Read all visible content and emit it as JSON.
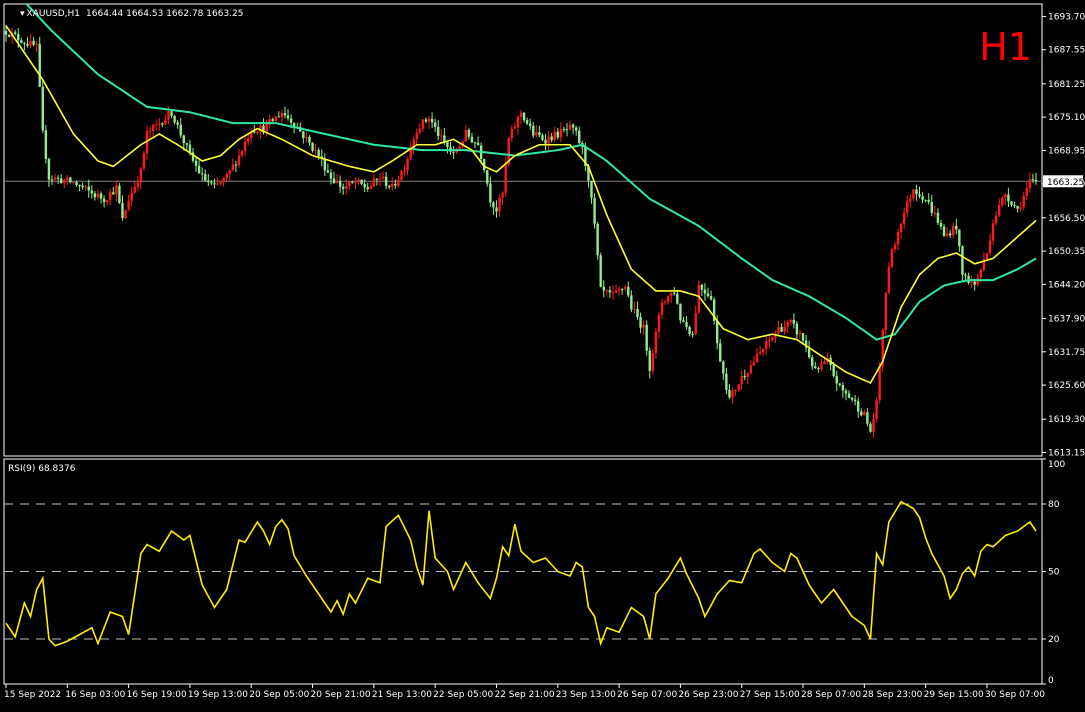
{
  "header": {
    "symbol": "XAUUSD,H1",
    "ohlc": "1664.44 1664.53 1662.78 1663.25",
    "timeframe_label": "H1"
  },
  "colors": {
    "background": "#000000",
    "axis": "#ffffff",
    "bull": "#ff1a1a",
    "bear": "#90ee90",
    "ma_fast": "#ffff33",
    "ma_slow": "#2ee8a4",
    "rsi": "#ffee00",
    "timeframe": "#ff0000",
    "price_line": "#808080"
  },
  "chart_data": [
    {
      "type": "candlestick",
      "title": "XAUUSD,H1",
      "yticks": [
        "1693.70",
        "1687.55",
        "1681.25",
        "1675.10",
        "1668.95",
        "1662.80",
        "1656.50",
        "1650.35",
        "1644.20",
        "1637.90",
        "1631.75",
        "1625.60",
        "1619.30",
        "1613.15"
      ],
      "ylim": [
        1612.5,
        1696.0
      ],
      "current_price": "1663.25",
      "anchors": [
        [
          0,
          1691
        ],
        [
          6,
          1689
        ],
        [
          10,
          1688
        ],
        [
          12,
          1672
        ],
        [
          14,
          1664
        ],
        [
          22,
          1663
        ],
        [
          28,
          1661
        ],
        [
          32,
          1660
        ],
        [
          36,
          1662
        ],
        [
          38,
          1656
        ],
        [
          40,
          1660
        ],
        [
          44,
          1665
        ],
        [
          46,
          1672
        ],
        [
          50,
          1674
        ],
        [
          54,
          1676
        ],
        [
          57,
          1672
        ],
        [
          60,
          1668
        ],
        [
          64,
          1664
        ],
        [
          68,
          1662
        ],
        [
          72,
          1664
        ],
        [
          76,
          1668
        ],
        [
          80,
          1673
        ],
        [
          84,
          1673
        ],
        [
          90,
          1676
        ],
        [
          94,
          1674
        ],
        [
          98,
          1671
        ],
        [
          102,
          1668
        ],
        [
          106,
          1664
        ],
        [
          110,
          1662
        ],
        [
          114,
          1663
        ],
        [
          118,
          1662
        ],
        [
          122,
          1664
        ],
        [
          126,
          1662
        ],
        [
          130,
          1666
        ],
        [
          134,
          1673
        ],
        [
          138,
          1675
        ],
        [
          142,
          1671
        ],
        [
          146,
          1668
        ],
        [
          150,
          1672
        ],
        [
          154,
          1670
        ],
        [
          156,
          1666
        ],
        [
          158,
          1660
        ],
        [
          160,
          1658
        ],
        [
          162,
          1661
        ],
        [
          164,
          1671
        ],
        [
          168,
          1676
        ],
        [
          172,
          1672
        ],
        [
          176,
          1671
        ],
        [
          180,
          1672
        ],
        [
          184,
          1673
        ],
        [
          186,
          1672
        ],
        [
          188,
          1669
        ],
        [
          190,
          1664
        ],
        [
          192,
          1655
        ],
        [
          194,
          1643
        ],
        [
          198,
          1642
        ],
        [
          202,
          1644
        ],
        [
          204,
          1640
        ],
        [
          208,
          1636
        ],
        [
          210,
          1629
        ],
        [
          214,
          1641
        ],
        [
          218,
          1643
        ],
        [
          220,
          1638
        ],
        [
          224,
          1635
        ],
        [
          226,
          1644
        ],
        [
          230,
          1642
        ],
        [
          232,
          1633
        ],
        [
          236,
          1623
        ],
        [
          240,
          1627
        ],
        [
          244,
          1630
        ],
        [
          248,
          1633
        ],
        [
          252,
          1636
        ],
        [
          256,
          1637
        ],
        [
          260,
          1634
        ],
        [
          264,
          1628
        ],
        [
          268,
          1630
        ],
        [
          272,
          1625
        ],
        [
          276,
          1623
        ],
        [
          280,
          1620
        ],
        [
          282,
          1617
        ],
        [
          284,
          1622
        ],
        [
          286,
          1636
        ],
        [
          288,
          1648
        ],
        [
          292,
          1656
        ],
        [
          296,
          1662
        ],
        [
          300,
          1660
        ],
        [
          304,
          1656
        ],
        [
          306,
          1653
        ],
        [
          310,
          1655
        ],
        [
          312,
          1646
        ],
        [
          316,
          1644
        ],
        [
          320,
          1650
        ],
        [
          322,
          1656
        ],
        [
          326,
          1661
        ],
        [
          330,
          1658
        ],
        [
          334,
          1663
        ],
        [
          336,
          1663
        ]
      ],
      "ma_fast_anchors": [
        [
          0,
          1692
        ],
        [
          12,
          1682
        ],
        [
          22,
          1672
        ],
        [
          30,
          1667
        ],
        [
          35,
          1666
        ],
        [
          44,
          1670
        ],
        [
          50,
          1672
        ],
        [
          56,
          1670
        ],
        [
          64,
          1667
        ],
        [
          70,
          1668
        ],
        [
          76,
          1671
        ],
        [
          82,
          1673
        ],
        [
          90,
          1671
        ],
        [
          100,
          1668
        ],
        [
          112,
          1666
        ],
        [
          120,
          1665
        ],
        [
          126,
          1667
        ],
        [
          134,
          1670
        ],
        [
          140,
          1670
        ],
        [
          146,
          1671
        ],
        [
          152,
          1669
        ],
        [
          156,
          1666
        ],
        [
          160,
          1665
        ],
        [
          166,
          1668
        ],
        [
          174,
          1670
        ],
        [
          184,
          1670
        ],
        [
          190,
          1666
        ],
        [
          196,
          1657
        ],
        [
          204,
          1647
        ],
        [
          212,
          1643
        ],
        [
          220,
          1643
        ],
        [
          226,
          1642
        ],
        [
          234,
          1636
        ],
        [
          242,
          1634
        ],
        [
          250,
          1635
        ],
        [
          258,
          1634
        ],
        [
          266,
          1631
        ],
        [
          274,
          1628
        ],
        [
          282,
          1626
        ],
        [
          286,
          1630
        ],
        [
          292,
          1640
        ],
        [
          298,
          1646
        ],
        [
          304,
          1649
        ],
        [
          310,
          1650
        ],
        [
          316,
          1648
        ],
        [
          322,
          1649
        ],
        [
          328,
          1652
        ],
        [
          336,
          1656
        ]
      ],
      "ma_slow_anchors": [
        [
          0,
          1700
        ],
        [
          15,
          1691
        ],
        [
          30,
          1683
        ],
        [
          46,
          1677
        ],
        [
          60,
          1676
        ],
        [
          74,
          1674
        ],
        [
          88,
          1674
        ],
        [
          104,
          1672
        ],
        [
          120,
          1670
        ],
        [
          136,
          1669
        ],
        [
          150,
          1669
        ],
        [
          166,
          1668
        ],
        [
          180,
          1669
        ],
        [
          188,
          1670
        ],
        [
          196,
          1667
        ],
        [
          210,
          1660
        ],
        [
          226,
          1655
        ],
        [
          240,
          1649
        ],
        [
          250,
          1645
        ],
        [
          262,
          1642
        ],
        [
          274,
          1638
        ],
        [
          284,
          1634
        ],
        [
          290,
          1635
        ],
        [
          298,
          1641
        ],
        [
          306,
          1644
        ],
        [
          314,
          1645
        ],
        [
          322,
          1645
        ],
        [
          330,
          1647
        ],
        [
          336,
          1649
        ]
      ]
    },
    {
      "type": "line",
      "title": "RSI(9) 68.8376",
      "name": "RSI(9)",
      "value": "68.8376",
      "yticks": [
        100,
        80,
        50,
        20,
        0
      ],
      "ylim": [
        0,
        100
      ],
      "levels": [
        80,
        50,
        20
      ],
      "x_range": [
        0,
        336
      ],
      "anchors": [
        [
          0,
          27
        ],
        [
          3,
          21
        ],
        [
          6,
          36
        ],
        [
          8,
          30
        ],
        [
          10,
          42
        ],
        [
          12,
          47
        ],
        [
          14,
          20
        ],
        [
          16,
          17
        ],
        [
          20,
          19
        ],
        [
          24,
          22
        ],
        [
          28,
          25
        ],
        [
          30,
          18
        ],
        [
          34,
          32
        ],
        [
          38,
          30
        ],
        [
          40,
          22
        ],
        [
          44,
          58
        ],
        [
          46,
          62
        ],
        [
          50,
          59
        ],
        [
          54,
          68
        ],
        [
          58,
          64
        ],
        [
          60,
          66
        ],
        [
          62,
          55
        ],
        [
          64,
          44
        ],
        [
          68,
          34
        ],
        [
          72,
          42
        ],
        [
          76,
          64
        ],
        [
          78,
          63
        ],
        [
          82,
          72
        ],
        [
          84,
          68
        ],
        [
          86,
          62
        ],
        [
          88,
          70
        ],
        [
          90,
          73
        ],
        [
          92,
          69
        ],
        [
          94,
          57
        ],
        [
          98,
          48
        ],
        [
          102,
          40
        ],
        [
          106,
          32
        ],
        [
          108,
          37
        ],
        [
          110,
          31
        ],
        [
          112,
          40
        ],
        [
          114,
          36
        ],
        [
          118,
          47
        ],
        [
          122,
          45
        ],
        [
          124,
          70
        ],
        [
          128,
          75
        ],
        [
          132,
          64
        ],
        [
          134,
          52
        ],
        [
          136,
          44
        ],
        [
          138,
          77
        ],
        [
          140,
          56
        ],
        [
          144,
          50
        ],
        [
          146,
          42
        ],
        [
          150,
          54
        ],
        [
          154,
          45
        ],
        [
          158,
          38
        ],
        [
          160,
          47
        ],
        [
          162,
          61
        ],
        [
          164,
          57
        ],
        [
          166,
          71
        ],
        [
          168,
          59
        ],
        [
          172,
          54
        ],
        [
          176,
          56
        ],
        [
          180,
          50
        ],
        [
          184,
          48
        ],
        [
          186,
          54
        ],
        [
          188,
          52
        ],
        [
          190,
          34
        ],
        [
          192,
          30
        ],
        [
          194,
          18
        ],
        [
          196,
          25
        ],
        [
          200,
          23
        ],
        [
          204,
          34
        ],
        [
          208,
          30
        ],
        [
          210,
          20
        ],
        [
          212,
          40
        ],
        [
          216,
          47
        ],
        [
          220,
          56
        ],
        [
          222,
          49
        ],
        [
          226,
          38
        ],
        [
          228,
          30
        ],
        [
          232,
          40
        ],
        [
          236,
          46
        ],
        [
          240,
          45
        ],
        [
          244,
          58
        ],
        [
          246,
          60
        ],
        [
          250,
          54
        ],
        [
          254,
          50
        ],
        [
          256,
          58
        ],
        [
          258,
          56
        ],
        [
          262,
          44
        ],
        [
          266,
          36
        ],
        [
          270,
          42
        ],
        [
          274,
          34
        ],
        [
          276,
          30
        ],
        [
          280,
          26
        ],
        [
          282,
          20
        ],
        [
          284,
          58
        ],
        [
          286,
          53
        ],
        [
          288,
          72
        ],
        [
          292,
          81
        ],
        [
          296,
          78
        ],
        [
          298,
          74
        ],
        [
          300,
          65
        ],
        [
          302,
          58
        ],
        [
          304,
          53
        ],
        [
          306,
          48
        ],
        [
          308,
          38
        ],
        [
          310,
          42
        ],
        [
          312,
          49
        ],
        [
          314,
          52
        ],
        [
          316,
          48
        ],
        [
          318,
          59
        ],
        [
          320,
          62
        ],
        [
          322,
          61
        ],
        [
          326,
          66
        ],
        [
          330,
          68
        ],
        [
          334,
          72
        ],
        [
          336,
          68
        ]
      ]
    }
  ],
  "x_axis": {
    "ticks": [
      {
        "label": "15 Sep 2022",
        "idx": 0
      },
      {
        "label": "16 Sep 03:00",
        "idx": 20
      },
      {
        "label": "16 Sep 19:00",
        "idx": 40
      },
      {
        "label": "19 Sep 13:00",
        "idx": 60
      },
      {
        "label": "20 Sep 05:00",
        "idx": 80
      },
      {
        "label": "20 Sep 21:00",
        "idx": 100
      },
      {
        "label": "21 Sep 13:00",
        "idx": 120
      },
      {
        "label": "22 Sep 05:00",
        "idx": 140
      },
      {
        "label": "22 Sep 21:00",
        "idx": 160
      },
      {
        "label": "23 Sep 13:00",
        "idx": 180
      },
      {
        "label": "26 Sep 07:00",
        "idx": 200
      },
      {
        "label": "26 Sep 23:00",
        "idx": 220
      },
      {
        "label": "27 Sep 15:00",
        "idx": 240
      },
      {
        "label": "28 Sep 07:00",
        "idx": 260
      },
      {
        "label": "28 Sep 23:00",
        "idx": 280
      },
      {
        "label": "29 Sep 15:00",
        "idx": 300
      },
      {
        "label": "30 Sep 07:00",
        "idx": 320
      }
    ]
  }
}
